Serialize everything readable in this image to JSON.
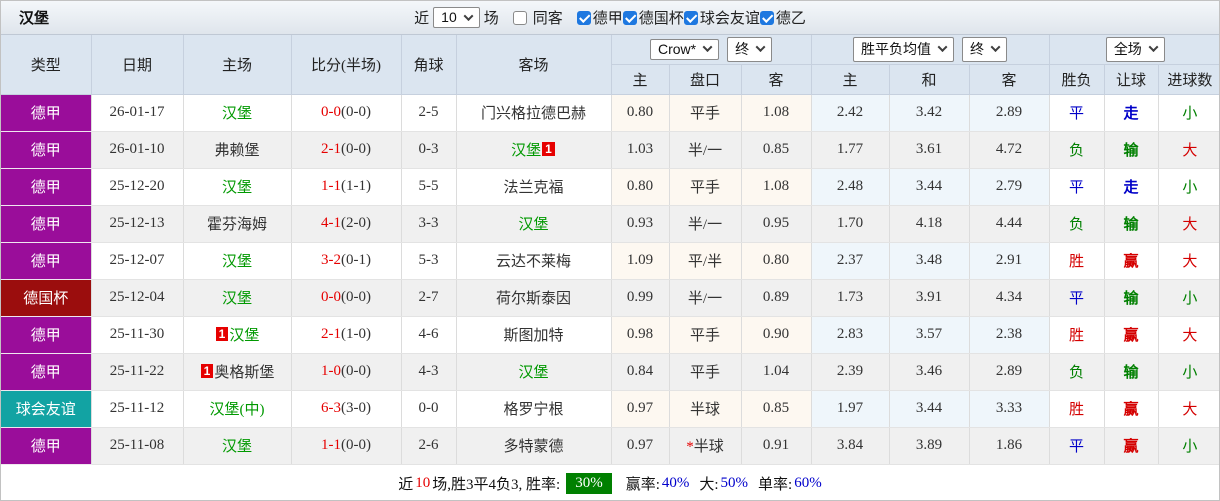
{
  "title": "汉堡",
  "topbar": {
    "near_label": "近",
    "near_count": "10",
    "unit_label": "场",
    "same_away": {
      "label": "同客",
      "checked": false
    },
    "filters": [
      {
        "label": "德甲",
        "checked": true
      },
      {
        "label": "德国杯",
        "checked": true
      },
      {
        "label": "球会友谊",
        "checked": true
      },
      {
        "label": "德乙",
        "checked": true
      }
    ]
  },
  "controls": {
    "odds_company": "Crow*",
    "odds_stage": "终",
    "avg_name": "胜平负均值",
    "avg_stage": "终",
    "scope": "全场"
  },
  "headers": {
    "type": "类型",
    "date": "日期",
    "home": "主场",
    "score": "比分(半场)",
    "corner": "角球",
    "away": "客场",
    "odds_home": "主",
    "odds_line": "盘口",
    "odds_away": "客",
    "avg_home": "主",
    "avg_draw": "和",
    "avg_away": "客",
    "wdl": "胜负",
    "handicap": "让球",
    "goals": "进球数"
  },
  "colors": {
    "league_bundesliga": "#9A0D9A",
    "league_dfb_pokal": "#9B0D0D",
    "league_club_friendly": "#12A3A3",
    "win_red": "#D40000",
    "draw_blue": "#0000C8",
    "loss_green": "#008000",
    "score_red": "#E60000",
    "team_green": "#009900",
    "win_rate_badge_bg": "#008000",
    "footer_value_blue": "#0000CC"
  },
  "table_rows": [
    {
      "type": "德甲",
      "type_color": "#9A0D9A",
      "date": "26-01-17",
      "home": {
        "name": "汉堡",
        "green": true,
        "badge": ""
      },
      "score": "0-0",
      "half": "(0-0)",
      "corner": "2-5",
      "away": {
        "name": "门兴格拉德巴赫",
        "green": false,
        "badge": ""
      },
      "odds": {
        "home": "0.80",
        "line": "平手",
        "star": false,
        "away": "1.08"
      },
      "avg": [
        "2.42",
        "3.42",
        "2.89"
      ],
      "res": [
        [
          "平",
          "blue"
        ],
        [
          "走",
          "blue"
        ],
        [
          "小",
          "green"
        ]
      ]
    },
    {
      "type": "德甲",
      "type_color": "#9A0D9A",
      "date": "26-01-10",
      "home": {
        "name": "弗赖堡",
        "green": false,
        "badge": ""
      },
      "score": "2-1",
      "half": "(0-0)",
      "corner": "0-3",
      "away": {
        "name": "汉堡",
        "green": true,
        "badge": "1",
        "badge_pos": "after"
      },
      "odds": {
        "home": "1.03",
        "line": "半/一",
        "star": false,
        "away": "0.85"
      },
      "avg": [
        "1.77",
        "3.61",
        "4.72"
      ],
      "res": [
        [
          "负",
          "green"
        ],
        [
          "输",
          "green"
        ],
        [
          "大",
          "red"
        ]
      ]
    },
    {
      "type": "德甲",
      "type_color": "#9A0D9A",
      "date": "25-12-20",
      "home": {
        "name": "汉堡",
        "green": true,
        "badge": ""
      },
      "score": "1-1",
      "half": "(1-1)",
      "corner": "5-5",
      "away": {
        "name": "法兰克福",
        "green": false,
        "badge": ""
      },
      "odds": {
        "home": "0.80",
        "line": "平手",
        "star": false,
        "away": "1.08"
      },
      "avg": [
        "2.48",
        "3.44",
        "2.79"
      ],
      "res": [
        [
          "平",
          "blue"
        ],
        [
          "走",
          "blue"
        ],
        [
          "小",
          "green"
        ]
      ]
    },
    {
      "type": "德甲",
      "type_color": "#9A0D9A",
      "date": "25-12-13",
      "home": {
        "name": "霍芬海姆",
        "green": false,
        "badge": ""
      },
      "score": "4-1",
      "half": "(2-0)",
      "corner": "3-3",
      "away": {
        "name": "汉堡",
        "green": true,
        "badge": ""
      },
      "odds": {
        "home": "0.93",
        "line": "半/一",
        "star": false,
        "away": "0.95"
      },
      "avg": [
        "1.70",
        "4.18",
        "4.44"
      ],
      "res": [
        [
          "负",
          "green"
        ],
        [
          "输",
          "green"
        ],
        [
          "大",
          "red"
        ]
      ]
    },
    {
      "type": "德甲",
      "type_color": "#9A0D9A",
      "date": "25-12-07",
      "home": {
        "name": "汉堡",
        "green": true,
        "badge": ""
      },
      "score": "3-2",
      "half": "(0-1)",
      "corner": "5-3",
      "away": {
        "name": "云达不莱梅",
        "green": false,
        "badge": ""
      },
      "odds": {
        "home": "1.09",
        "line": "平/半",
        "star": false,
        "away": "0.80"
      },
      "avg": [
        "2.37",
        "3.48",
        "2.91"
      ],
      "res": [
        [
          "胜",
          "red"
        ],
        [
          "赢",
          "red"
        ],
        [
          "大",
          "red"
        ]
      ]
    },
    {
      "type": "德国杯",
      "type_color": "#9B0D0D",
      "date": "25-12-04",
      "home": {
        "name": "汉堡",
        "green": true,
        "badge": ""
      },
      "score": "0-0",
      "half": "(0-0)",
      "corner": "2-7",
      "away": {
        "name": "荷尔斯泰因",
        "green": false,
        "badge": ""
      },
      "odds": {
        "home": "0.99",
        "line": "半/一",
        "star": false,
        "away": "0.89"
      },
      "avg": [
        "1.73",
        "3.91",
        "4.34"
      ],
      "res": [
        [
          "平",
          "blue"
        ],
        [
          "输",
          "green"
        ],
        [
          "小",
          "green"
        ]
      ]
    },
    {
      "type": "德甲",
      "type_color": "#9A0D9A",
      "date": "25-11-30",
      "home": {
        "name": "汉堡",
        "green": true,
        "badge": "1",
        "badge_pos": "before"
      },
      "score": "2-1",
      "half": "(1-0)",
      "corner": "4-6",
      "away": {
        "name": "斯图加特",
        "green": false,
        "badge": ""
      },
      "odds": {
        "home": "0.98",
        "line": "平手",
        "star": false,
        "away": "0.90"
      },
      "avg": [
        "2.83",
        "3.57",
        "2.38"
      ],
      "res": [
        [
          "胜",
          "red"
        ],
        [
          "赢",
          "red"
        ],
        [
          "大",
          "red"
        ]
      ]
    },
    {
      "type": "德甲",
      "type_color": "#9A0D9A",
      "date": "25-11-22",
      "home": {
        "name": "奥格斯堡",
        "green": false,
        "badge": "1",
        "badge_pos": "before"
      },
      "score": "1-0",
      "half": "(0-0)",
      "corner": "4-3",
      "away": {
        "name": "汉堡",
        "green": true,
        "badge": ""
      },
      "odds": {
        "home": "0.84",
        "line": "平手",
        "star": false,
        "away": "1.04"
      },
      "avg": [
        "2.39",
        "3.46",
        "2.89"
      ],
      "res": [
        [
          "负",
          "green"
        ],
        [
          "输",
          "green"
        ],
        [
          "小",
          "green"
        ]
      ]
    },
    {
      "type": "球会友谊",
      "type_color": "#12A3A3",
      "date": "25-11-12",
      "home": {
        "name": "汉堡(中)",
        "green": true,
        "badge": ""
      },
      "score": "6-3",
      "half": "(3-0)",
      "corner": "0-0",
      "away": {
        "name": "格罗宁根",
        "green": false,
        "badge": ""
      },
      "odds": {
        "home": "0.97",
        "line": "半球",
        "star": false,
        "away": "0.85"
      },
      "avg": [
        "1.97",
        "3.44",
        "3.33"
      ],
      "res": [
        [
          "胜",
          "red"
        ],
        [
          "赢",
          "red"
        ],
        [
          "大",
          "red"
        ]
      ]
    },
    {
      "type": "德甲",
      "type_color": "#9A0D9A",
      "date": "25-11-08",
      "home": {
        "name": "汉堡",
        "green": true,
        "badge": ""
      },
      "score": "1-1",
      "half": "(0-0)",
      "corner": "2-6",
      "away": {
        "name": "多特蒙德",
        "green": false,
        "badge": ""
      },
      "odds": {
        "home": "0.97",
        "line": "半球",
        "star": true,
        "away": "0.91"
      },
      "avg": [
        "3.84",
        "3.89",
        "1.86"
      ],
      "res": [
        [
          "平",
          "blue"
        ],
        [
          "赢",
          "red"
        ],
        [
          "小",
          "green"
        ]
      ]
    }
  ],
  "footer": {
    "near_label": "近",
    "near_count": "10",
    "summary": "场,胜3平4负3, 胜率:",
    "win_rate": "30%",
    "seg2_label": "赢率:",
    "seg2_value": "40%",
    "seg3_label": "大:",
    "seg3_value": "50%",
    "seg4_label": "单率:",
    "seg4_value": "60%"
  }
}
